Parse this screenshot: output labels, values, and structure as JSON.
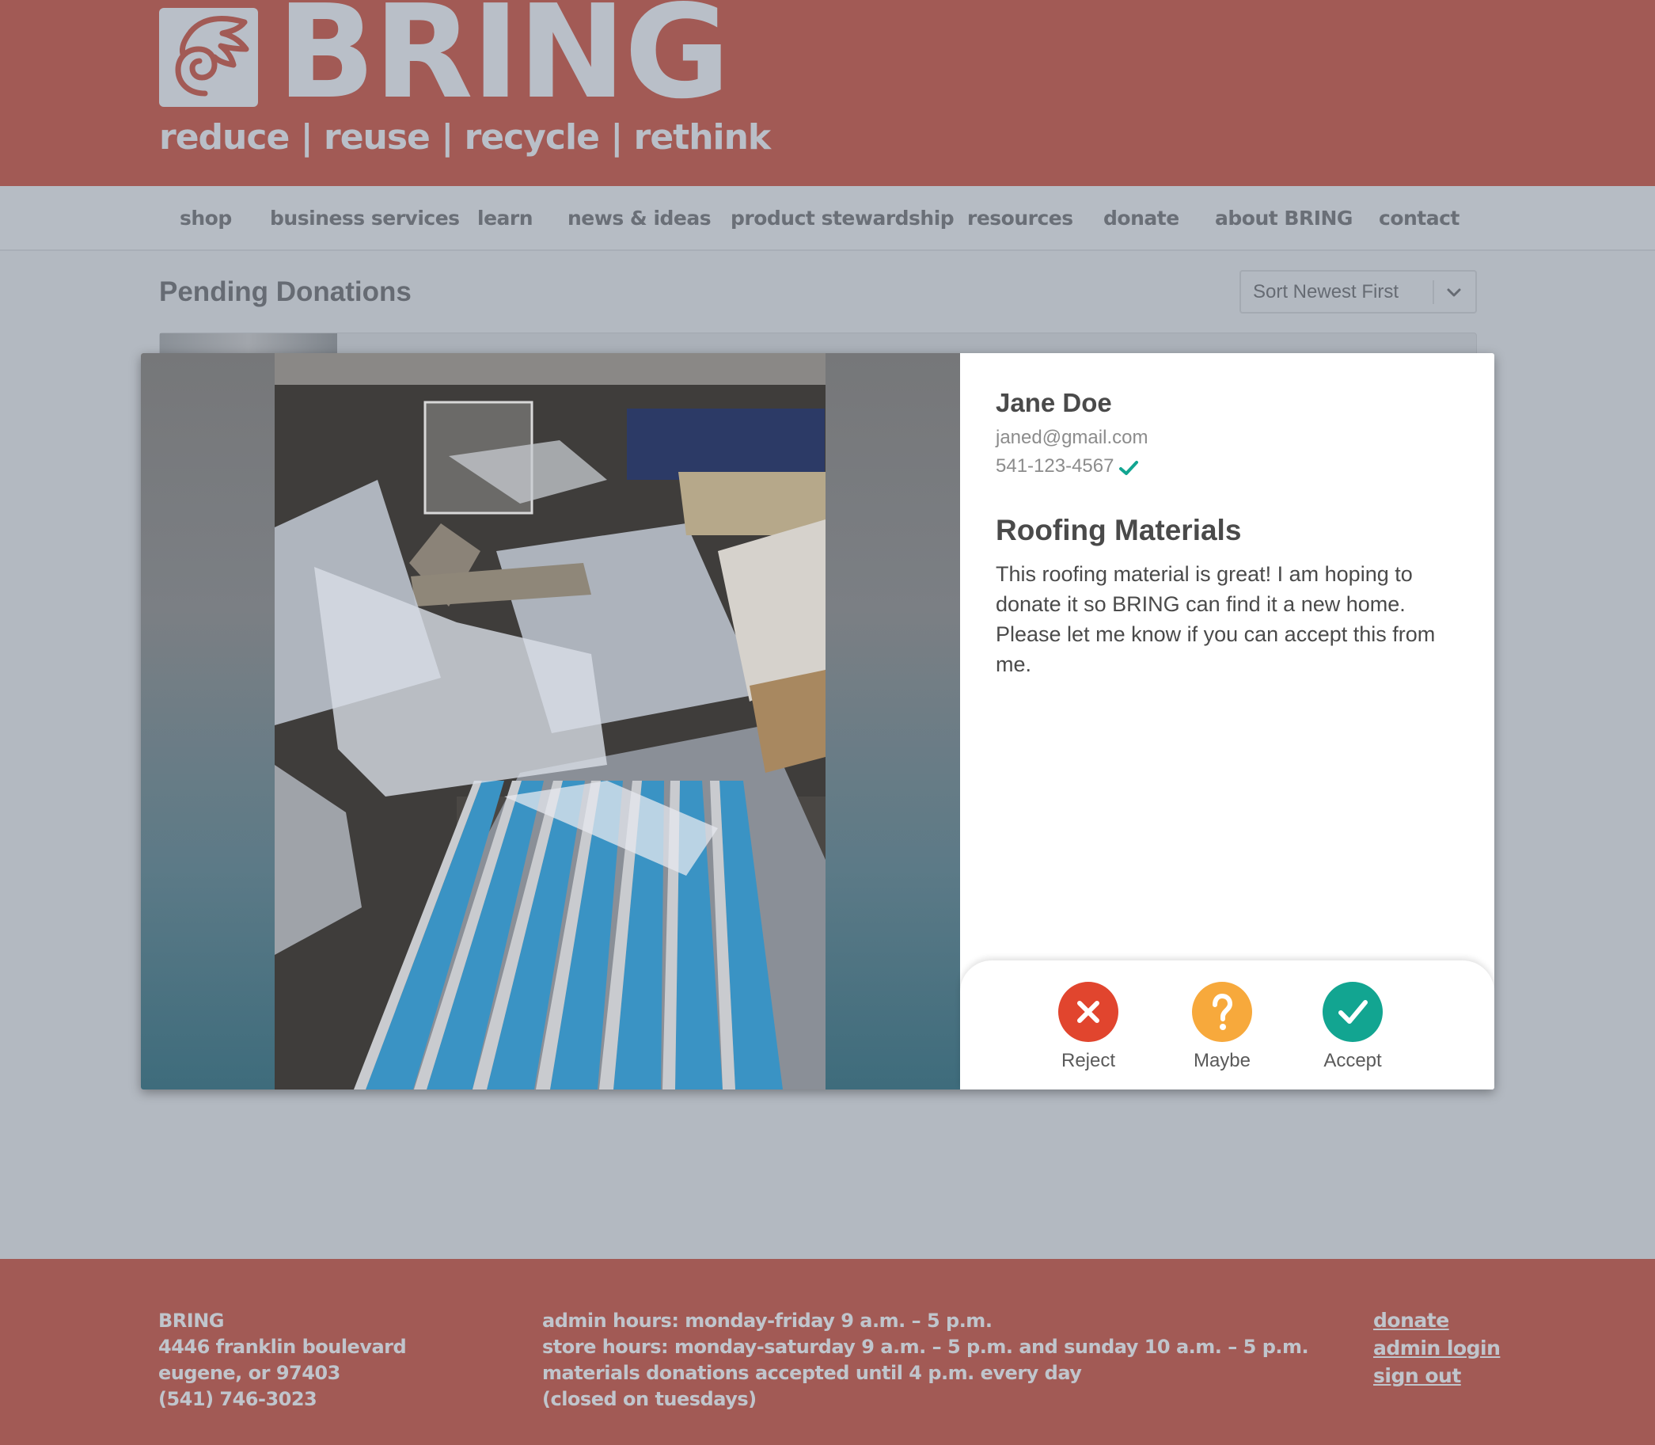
{
  "header": {
    "logo_text": "BRING",
    "tagline": "reduce | reuse | recycle | rethink"
  },
  "nav": {
    "items": [
      {
        "label": "shop"
      },
      {
        "label": "business services"
      },
      {
        "label": "learn"
      },
      {
        "label": "news & ideas"
      },
      {
        "label": "product stewardship"
      },
      {
        "label": "resources"
      },
      {
        "label": "donate"
      },
      {
        "label": "about BRING"
      },
      {
        "label": "contact"
      }
    ]
  },
  "page": {
    "title": "Pending Donations",
    "sort_label": "Sort Newest First"
  },
  "modal": {
    "donor_name": "Jane Doe",
    "donor_email": "janed@gmail.com",
    "donor_phone": "541-123-4567",
    "phone_verified": true,
    "item_title": "Roofing Materials",
    "item_description": "This roofing material is great! I am hoping to donate it so BRING can find it a new home. Please let me know if you can accept this from me.",
    "actions": [
      {
        "label": "Reject",
        "icon": "x-icon",
        "color": "#e1452e"
      },
      {
        "label": "Maybe",
        "icon": "question-icon",
        "color": "#f7a93c"
      },
      {
        "label": "Accept",
        "icon": "check-icon",
        "color": "#12a591"
      }
    ]
  },
  "footer": {
    "address_lines": [
      "BRING",
      "4446 franklin boulevard",
      "eugene, or 97403",
      "(541) 746-3023"
    ],
    "hours_lines": [
      "admin hours: monday-friday 9 a.m. – 5 p.m.",
      "store hours: monday-saturday 9 a.m. – 5 p.m. and sunday 10 a.m. – 5 p.m.",
      "materials donations accepted until 4 p.m. every day",
      "(closed on tuesdays)"
    ],
    "links": [
      {
        "label": "donate"
      },
      {
        "label": "admin login"
      },
      {
        "label": "sign out"
      }
    ]
  },
  "colors": {
    "brand_red": "#a25a55",
    "overlay_gray": "#b3b9c1",
    "verified_green": "#12a591"
  }
}
